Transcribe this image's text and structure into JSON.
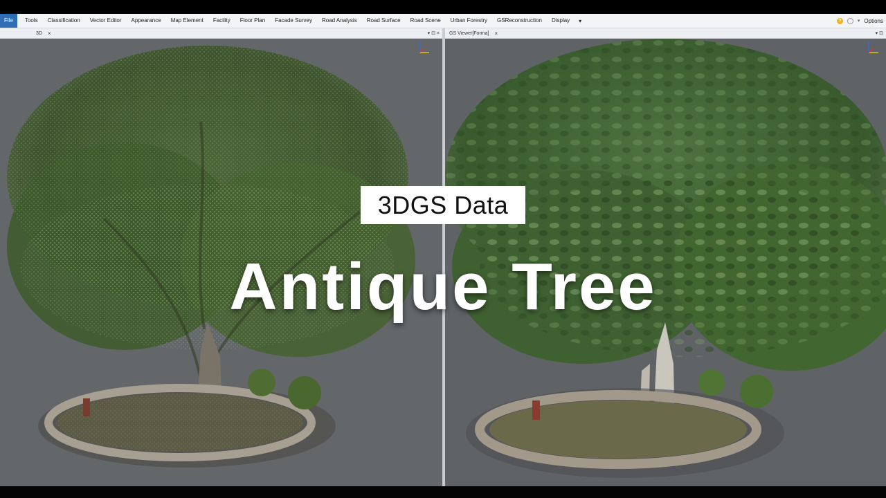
{
  "menu": {
    "items": [
      "File",
      "Tools",
      "Classification",
      "Vector Editor",
      "Appearance",
      "Map Element",
      "Facility",
      "Floor Plan",
      "Facade Survey",
      "Road Analysis",
      "Road Surface",
      "Road Scene",
      "Urban Forestry",
      "GSReconstruction",
      "Display"
    ],
    "more_label": "▾",
    "options_label": "Options"
  },
  "panes": {
    "left": {
      "tab_label": "3D",
      "close_label": "×",
      "controls": "▾ ⊡ ×"
    },
    "right": {
      "tab_label": "GS Viewer[Forma]",
      "close_label": "×",
      "controls": "▾ ⊡"
    }
  },
  "overlay": {
    "caption": "3DGS Data",
    "title": "Antique Tree"
  },
  "colors": {
    "menu_active": "#2f6db5",
    "viewport_bg": "#636769",
    "foliage": "#3f5a2c",
    "caption_bg": "#ffffff"
  },
  "icons": {
    "help": "help-icon",
    "settings": "gear-icon",
    "axis": "axis-gizmo-icon"
  }
}
